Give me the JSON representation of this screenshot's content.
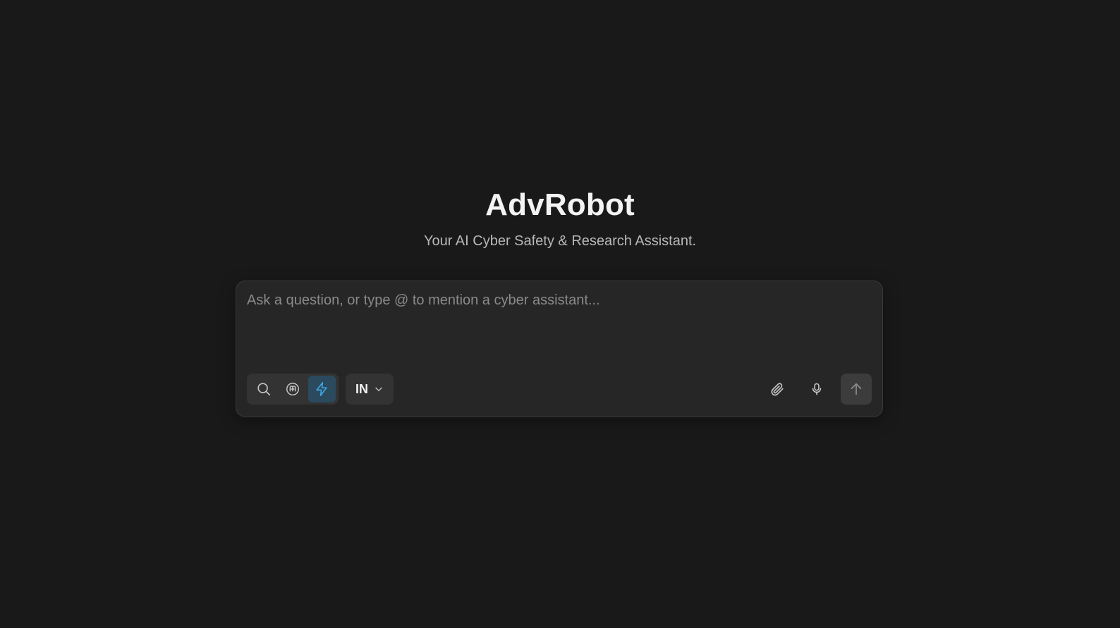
{
  "app": {
    "title": "AdvRobot",
    "subtitle": "Your AI Cyber Safety & Research Assistant."
  },
  "composer": {
    "placeholder": "Ask a question, or type @ to mention a cyber assistant...",
    "value": "",
    "modes": [
      {
        "icon": "search-icon",
        "active": false
      },
      {
        "icon": "brain-icon",
        "active": false
      },
      {
        "icon": "lightning-icon",
        "active": true
      }
    ],
    "language": {
      "selected": "IN",
      "icon": "chevron-down-icon"
    },
    "tools": [
      {
        "icon": "paperclip-icon"
      },
      {
        "icon": "microphone-icon"
      }
    ],
    "send": {
      "icon": "arrow-up-icon"
    }
  },
  "colors": {
    "background": "#191919",
    "composer_bg": "#262626",
    "active_mode_bg": "#2b4a5e",
    "active_mode_icon": "#3da5e0",
    "icon": "#c8c8c8"
  }
}
